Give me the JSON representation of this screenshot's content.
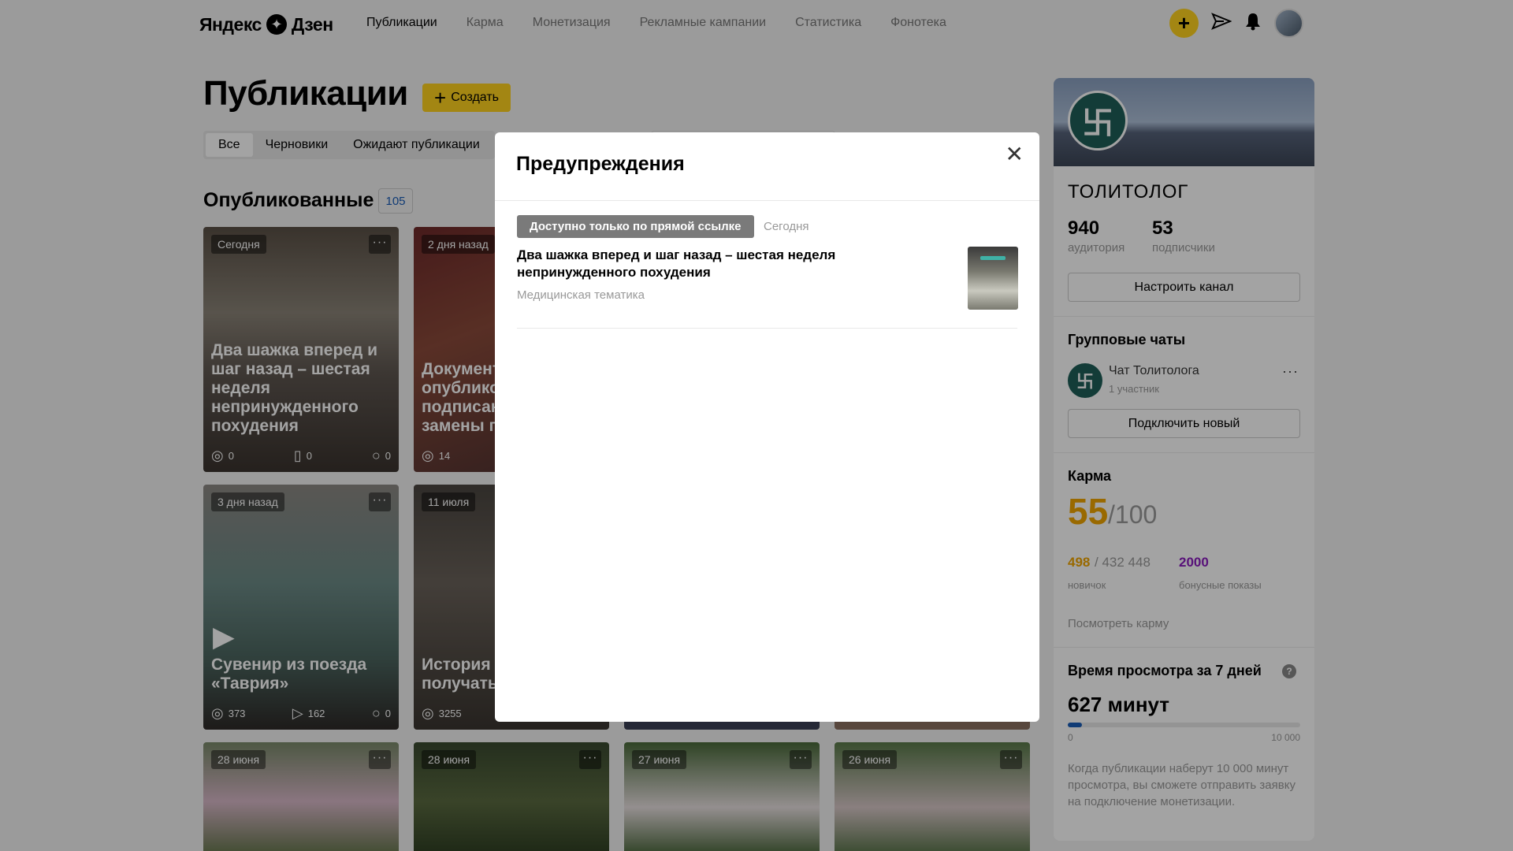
{
  "header": {
    "logo_left": "Яндекс",
    "logo_right": "Дзен",
    "nav": [
      "Публикации",
      "Карма",
      "Монетизация",
      "Рекламные кампании",
      "Статистика",
      "Фонотека"
    ]
  },
  "page": {
    "title": "Публикации",
    "create_label": "Создать",
    "tabs": [
      "Все",
      "Черновики",
      "Ожидают публикации"
    ],
    "section_title": "Опубликованные",
    "section_count": "105"
  },
  "cards": [
    {
      "date": "Сегодня",
      "title": "Два шажка вперед и шаг назад – шестая неделя непринужденного похудения",
      "views": "0",
      "reads": "0",
      "comments": "0"
    },
    {
      "date": "2 дня назад",
      "title": "Документ опубликован подписан изменил замены паспорта",
      "views": "14"
    },
    {
      "date": "3 дня назад",
      "title": "Сувенир из поезда «Таврия»",
      "views": "373",
      "plays": "162",
      "comments": "0"
    },
    {
      "date": "11 июля",
      "title": "История «нежданч получать лишним в",
      "views": "3255"
    },
    {
      "date": "28 июня"
    },
    {
      "date": "28 июня"
    },
    {
      "date": "27 июня"
    },
    {
      "date": "26 июня"
    }
  ],
  "modal": {
    "title": "Предупреждения",
    "badge": "Доступно только по прямой ссылке",
    "date": "Сегодня",
    "post_title": "Два шажка вперед и шаг назад – шестая неделя непринужденного похудения",
    "post_subtitle": "Медицинская тематика"
  },
  "sidebar": {
    "channel_name": "ТОЛИТОЛОГ",
    "audience": "940",
    "audience_label": "аудитория",
    "subscribers": "53",
    "subscribers_label": "подписчики",
    "settings_button": "Настроить канал",
    "group_chats_title": "Групповые чаты",
    "chat_name": "Чат Толитолога",
    "chat_members": "1 участник",
    "connect_button": "Подключить новый",
    "karma_title": "Карма",
    "karma_score": "55",
    "karma_max": "/100",
    "karma_points": "498",
    "karma_points_total": "/ 432 448",
    "karma_level": "новичок",
    "bonus": "2000",
    "bonus_label": "бонусные показы",
    "karma_link": "Посмотреть карму",
    "watch_title": "Время просмотра за 7 дней",
    "watch_value": "627 минут",
    "watch_progress": 0.0627,
    "scale_min": "0",
    "scale_max": "10 000",
    "watch_note": "Когда публикации наберут 10 000 минут просмотра, вы сможете отправить заявку на подключение монетизации."
  },
  "colors": {
    "accent": "#ffd21e",
    "karma": "#f0a500",
    "bonus": "#8a1bbd",
    "link": "#1a5db8"
  }
}
